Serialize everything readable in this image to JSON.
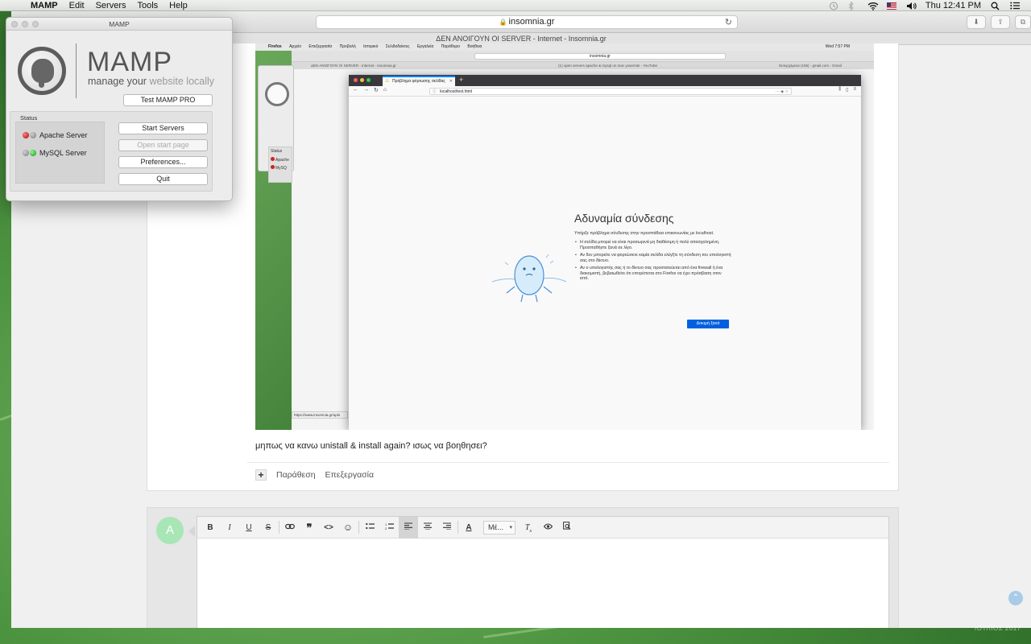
{
  "menubar": {
    "app_name": "MAMP",
    "menus": [
      "Edit",
      "Servers",
      "Tools",
      "Help"
    ],
    "clock": "Thu 12:41 PM"
  },
  "browser": {
    "url": "insomnia.gr",
    "page_title": "ΔΕΝ ΑΝΟΙΓΟΥΝ ΟΙ SERVER - Internet - Insomnia.gr"
  },
  "screenshot": {
    "menubar_items": [
      "Firefox",
      "Αρχείο",
      "Επεξεργασία",
      "Προβολή",
      "Ιστορικό",
      "Σελιδοδείκτες",
      "Εργαλεία",
      "Παράθυρο",
      "Βοήθεια"
    ],
    "menubar_clock": "Wed 7:57 PM",
    "bg_url": "insomnia.gr",
    "bg_tabs": [
      "ΔΕΝ ΑΝΟΙΓΟΥΝ ΟΙ SERVER - Internet - Insomnia.gr",
      "(1) open servers apache & mysql on mac yosemite - YouTube",
      "Εισερχόμενα (196) - gmail.com - Gmail"
    ],
    "tab_title": "Πρόβλημα φόρτωσης σελίδας",
    "address": "localhost/test.html",
    "error_title": "Αδυναμία σύνδεσης",
    "error_intro": "Υπήρξε πρόβλημα σύνδεσης στην προσπάθεια επικοινωνίας με localhost.",
    "error_bullets": [
      "Η σελίδα μπορεί να είναι προσωρινά μη διαθέσιμη ή πολύ απασχολημένη. Προσπαθήστε ξανά σε λίγο.",
      "Αν δεν μπορείτε να φορτώσετε καμία σελίδα ελέγξτε τη σύνδεση του υπολογιστή σας στο δίκτυο.",
      "Αν ο υπολογιστής σας ή το δίκτυο σας προστατεύεται από ένα firewall ή ένα διακομιστή, βεβαιωθείτε ότι επιτρέπεται στο Firefox να έχει πρόσβαση στον ιστό."
    ],
    "retry_label": "Δοκιμή ξανά",
    "status_url": "https://www.insomnia.gr/uplo",
    "mini_status_label": "Status",
    "mini_servers": [
      "Apache",
      "MySQ"
    ]
  },
  "post": {
    "text": "μηπως να κανω unistall & install again? ισως να βοηθησει?",
    "plus": "+",
    "actions": [
      "Παράθεση",
      "Επεξεργασία"
    ]
  },
  "reply": {
    "avatar_letter": "A",
    "toolbar": [
      "B",
      "I",
      "U",
      "S",
      "🔗",
      "❞",
      "<>",
      "☺",
      "≔",
      "⒈",
      "≡",
      "≡",
      "≡",
      "A",
      "Mέ...",
      "Tx",
      "👁",
      "🔍"
    ],
    "font_select": "Mέ..."
  },
  "footer": {
    "text": "ΙΟΥΛΙΟΣ 2017"
  },
  "mamp": {
    "window_title": "MAMP",
    "brand": "MAMP",
    "tagline_dark": "manage your",
    "tagline_light": "website locally",
    "pro_button": "Test MAMP PRO",
    "status_label": "Status",
    "servers": [
      {
        "name": "Apache Server",
        "state": "stopped"
      },
      {
        "name": "MySQL Server",
        "state": "running"
      }
    ],
    "buttons": {
      "start": "Start Servers",
      "open_start_page": "Open start page",
      "preferences": "Preferences...",
      "quit": "Quit"
    }
  },
  "colors": {
    "firefox_blue": "#0060df",
    "avatar_green": "#a8e6b6",
    "led_red": "#b00000",
    "led_green": "#1a8a1a"
  }
}
